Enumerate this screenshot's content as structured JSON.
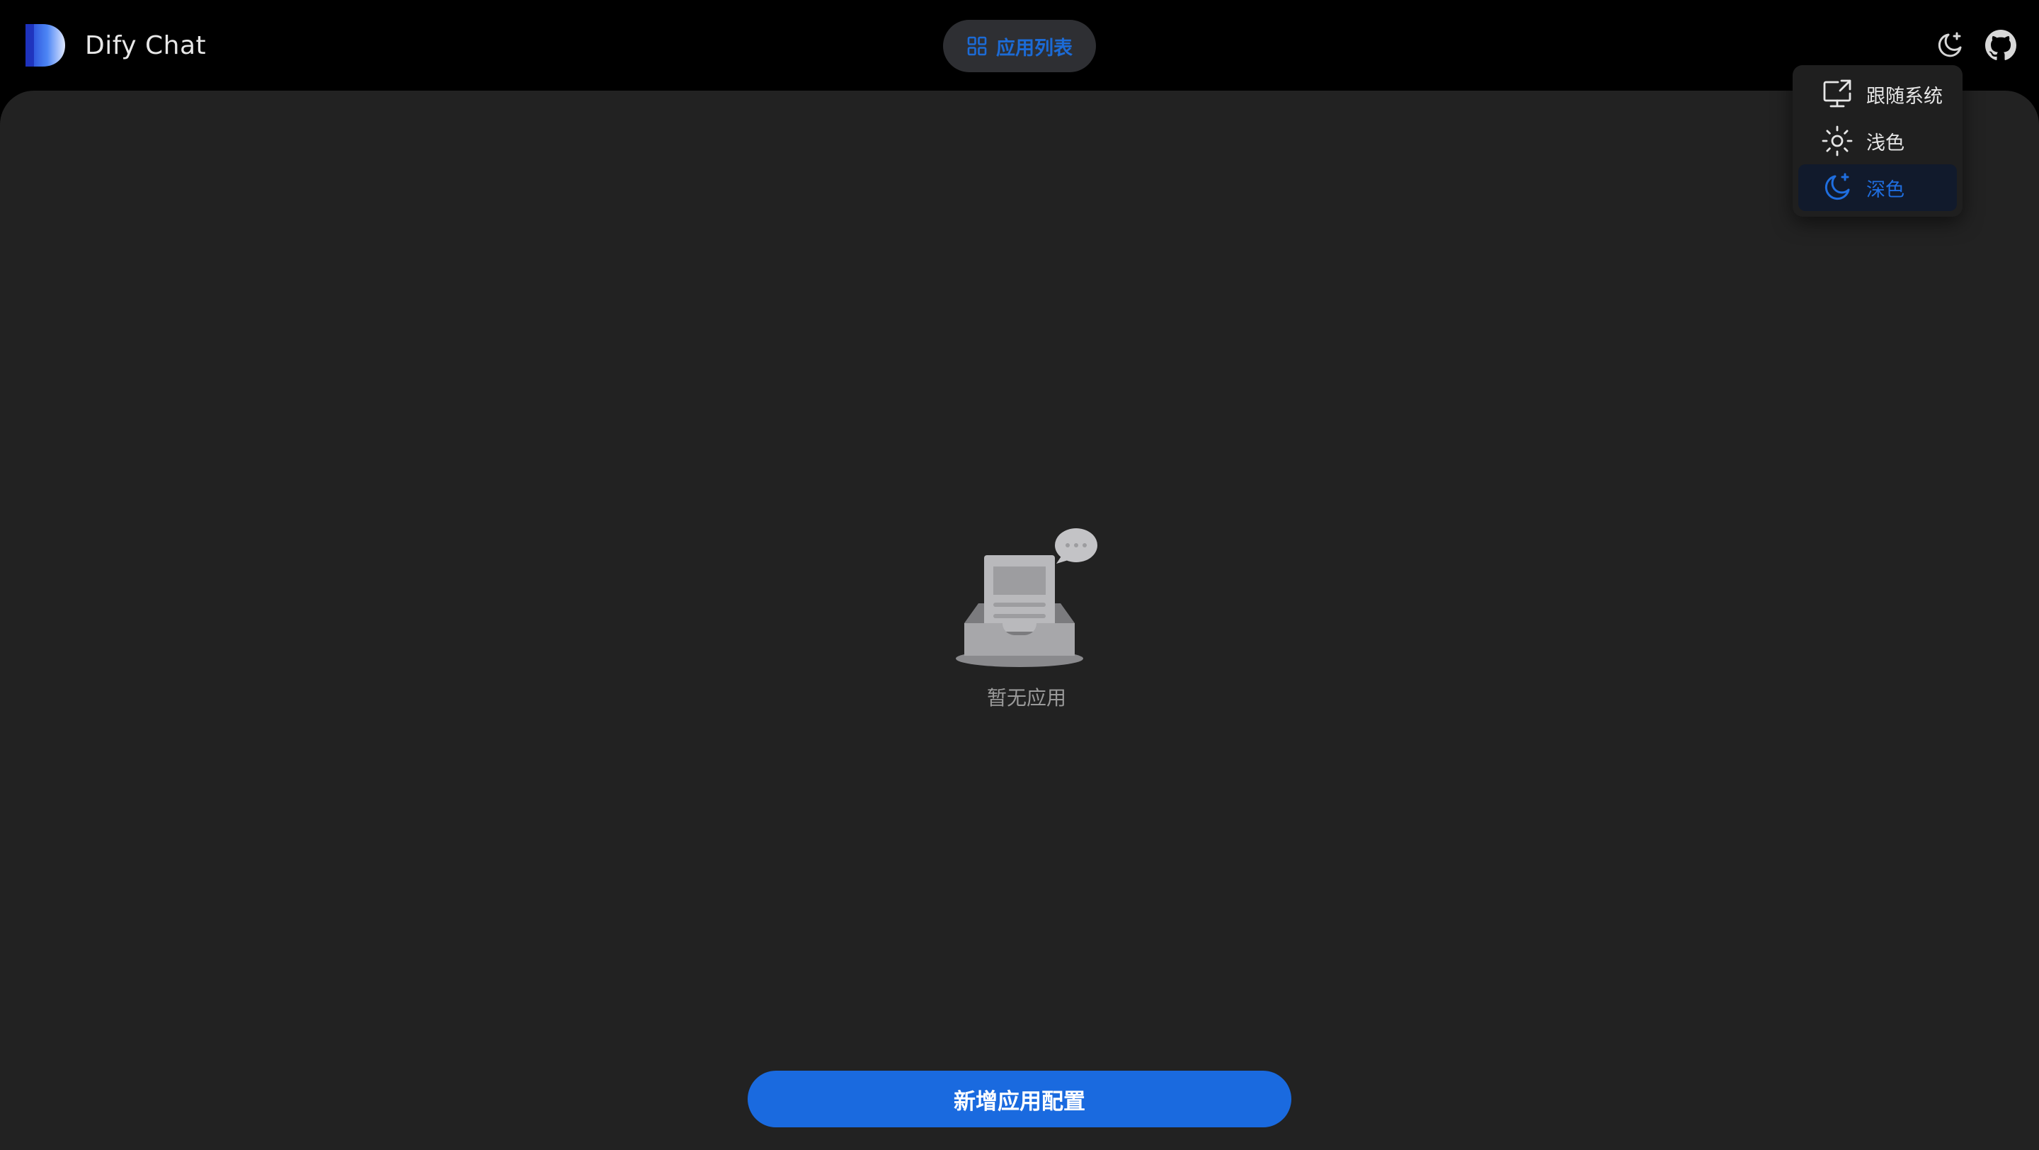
{
  "header": {
    "brand_name": "Dify Chat",
    "app_list_label": "应用列表"
  },
  "empty_state": {
    "text": "暂无应用"
  },
  "actions": {
    "new_config_label": "新增应用配置"
  },
  "theme_menu": {
    "items": [
      {
        "label": "跟随系统",
        "icon": "monitor-icon",
        "selected": false
      },
      {
        "label": "浅色",
        "icon": "sun-icon",
        "selected": false
      },
      {
        "label": "深色",
        "icon": "moon-icon",
        "selected": true
      }
    ]
  },
  "colors": {
    "accent": "#1a6adf",
    "page_background": "#000000",
    "panel_background": "#222222",
    "menu_selected_background": "#111a2c"
  }
}
